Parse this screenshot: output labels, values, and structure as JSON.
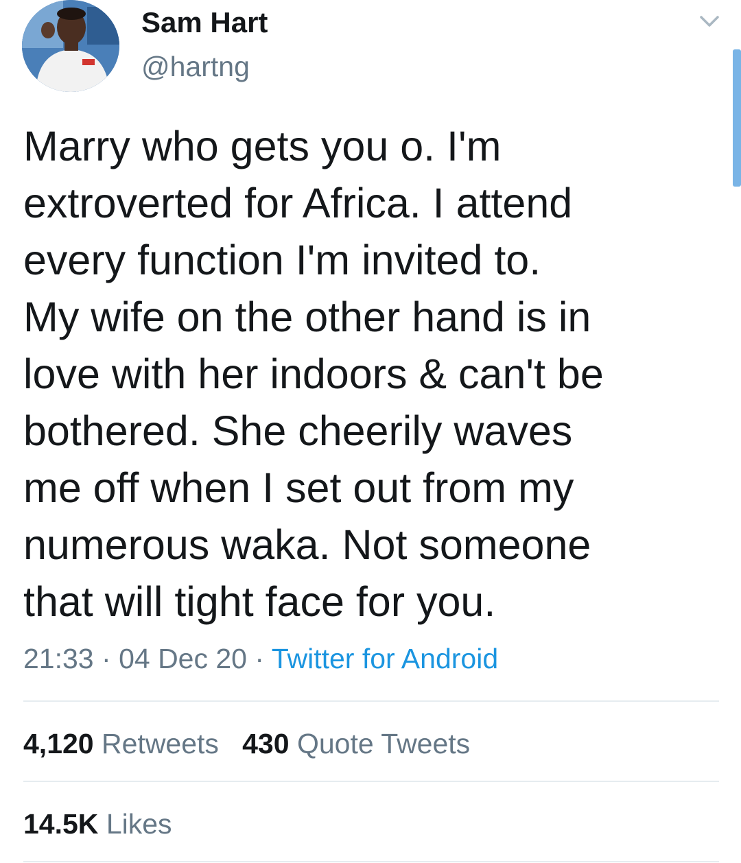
{
  "author": {
    "name": "Sam Hart",
    "handle": "@hartng"
  },
  "tweet": {
    "lines": [
      "Marry who gets you o. I'm",
      "extroverted for Africa. I attend",
      "every function I'm invited to.",
      "My wife on the other hand is in",
      "love with her indoors & can't be",
      "bothered. She cheerily waves",
      "me off when I set out from my",
      "numerous waka. Not someone",
      "that will tight face for you."
    ],
    "time": "21:33",
    "date": "04 Dec 20",
    "separator": "·",
    "source": "Twitter for Android"
  },
  "stats": {
    "retweets_count": "4,120",
    "retweets_label": "Retweets",
    "quotes_count": "430",
    "quotes_label": "Quote Tweets",
    "likes_count": "14.5K",
    "likes_label": "Likes"
  },
  "colors": {
    "text_primary": "#14171a",
    "text_secondary": "#657786",
    "link": "#1b95e0",
    "divider": "#e6ecf0",
    "scroll_indicator": "#79b4e6"
  },
  "icons": {
    "menu": "chevron-down-icon"
  }
}
